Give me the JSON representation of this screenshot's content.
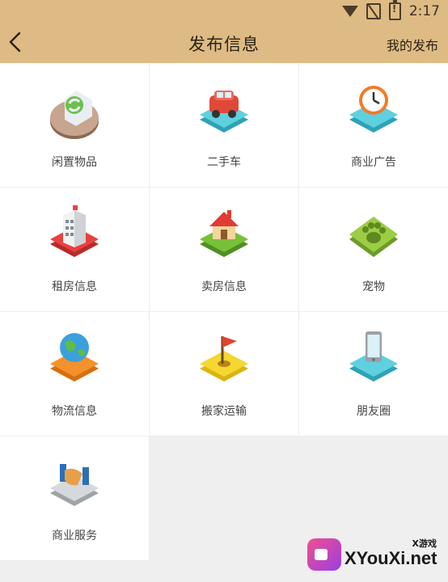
{
  "status": {
    "time": "2:17"
  },
  "nav": {
    "title": "发布信息",
    "my_posts": "我的发布"
  },
  "categories": [
    {
      "label": "闲置物品",
      "icon": "recycle-icon"
    },
    {
      "label": "二手车",
      "icon": "car-icon"
    },
    {
      "label": "商业广告",
      "icon": "clock-icon"
    },
    {
      "label": "租房信息",
      "icon": "building-icon"
    },
    {
      "label": "卖房信息",
      "icon": "house-icon"
    },
    {
      "label": "宠物",
      "icon": "paw-icon"
    },
    {
      "label": "物流信息",
      "icon": "globe-icon"
    },
    {
      "label": "搬家运输",
      "icon": "flag-icon"
    },
    {
      "label": "朋友圈",
      "icon": "phone-icon"
    },
    {
      "label": "商业服务",
      "icon": "handshake-icon"
    }
  ],
  "watermark": {
    "brand": "XYouXi.net",
    "tag": "X游戏"
  }
}
